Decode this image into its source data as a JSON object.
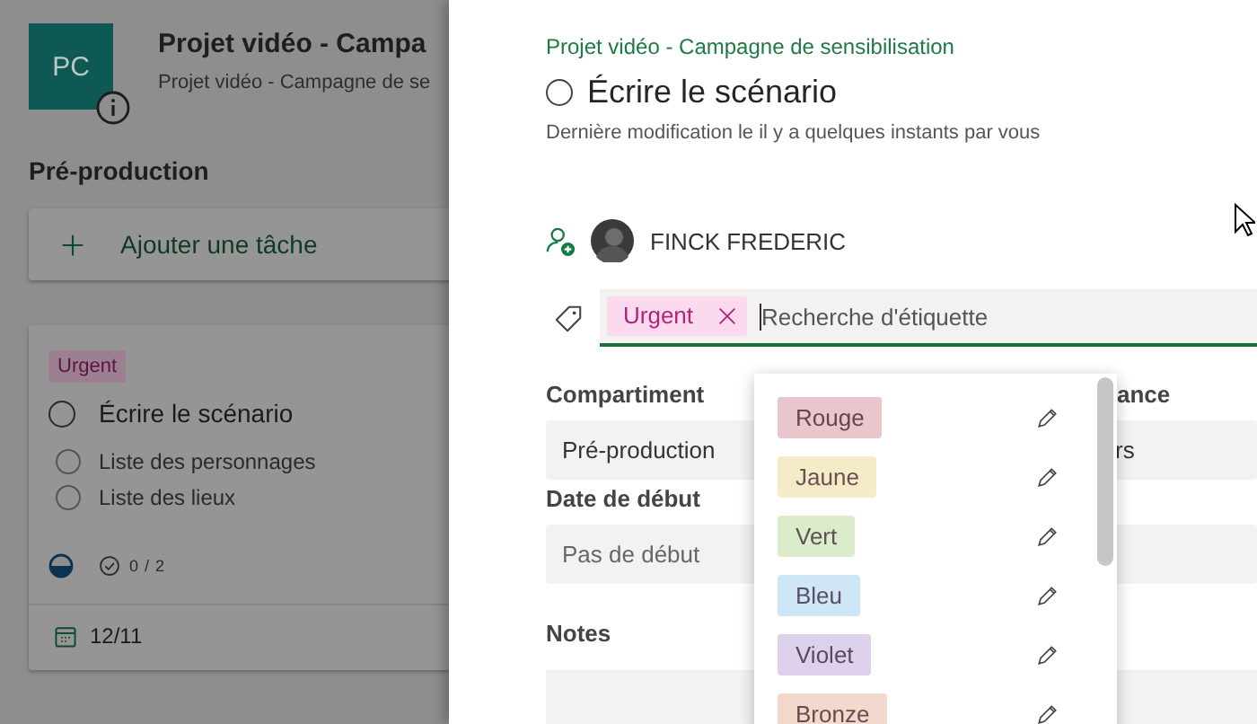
{
  "board": {
    "avatar_initials": "PC",
    "title": "Projet vidéo - Campa",
    "subtitle": "Projet vidéo - Campagne de se",
    "bucket": "Pré-production",
    "add_task": "Ajouter une tâche",
    "card": {
      "label": "Urgent",
      "title": "Écrire le scénario",
      "completed": false,
      "checklist": [
        {
          "text": "Liste des personnages",
          "checked": false
        },
        {
          "text": "Liste des lieux",
          "checked": false
        }
      ],
      "in_progress": true,
      "checklist_count": "0 / 2",
      "due": "12/11"
    }
  },
  "panel": {
    "plan": "Projet vidéo - Campagne de sensibilisation",
    "title": "Écrire le scénario",
    "completed": false,
    "modified": "Dernière modification le il y a quelques instants par vous",
    "assignee": "FINCK FREDERIC",
    "labels": [
      {
        "text": "Urgent"
      }
    ],
    "label_search": {
      "placeholder": "Recherche d'étiquette"
    },
    "fields": [
      {
        "label": "Compartiment",
        "value": "Pré-production",
        "placeholder": false
      },
      {
        "label": "ance",
        "value": "rs",
        "placeholder": false
      },
      {
        "label": "Date de début",
        "value": "Pas de début",
        "placeholder": true
      }
    ],
    "notes_label": "Notes",
    "label_menu": [
      {
        "name": "Rouge",
        "color": "#e9c6cc"
      },
      {
        "name": "Jaune",
        "color": "#f6ebc8"
      },
      {
        "name": "Vert",
        "color": "#dcebca"
      },
      {
        "name": "Bleu",
        "color": "#cfe6f7"
      },
      {
        "name": "Violet",
        "color": "#ddd1eb"
      },
      {
        "name": "Bronze",
        "color": "#f3d9cb"
      }
    ]
  }
}
